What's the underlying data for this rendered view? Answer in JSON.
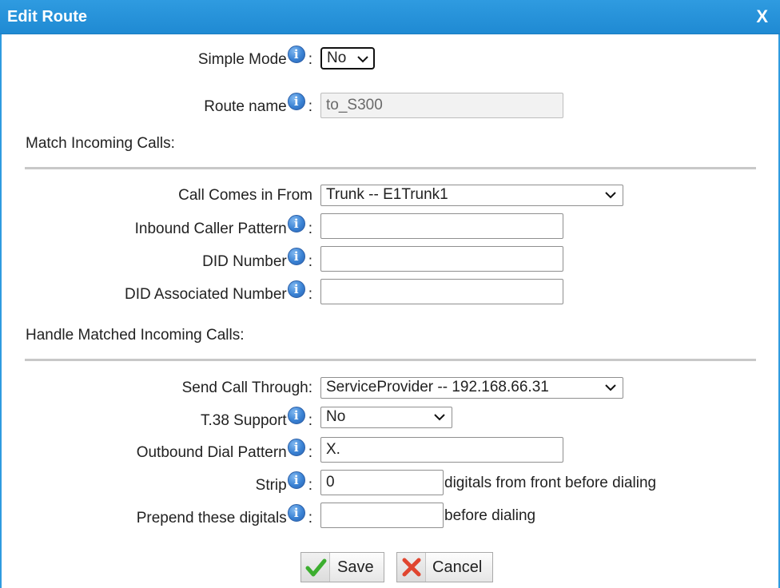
{
  "window": {
    "title": "Edit Route",
    "close_label": "X"
  },
  "colon": ":",
  "info_glyph": "i",
  "simple_mode": {
    "label": "Simple Mode",
    "value": "No"
  },
  "route_name": {
    "label": "Route name",
    "value": "to_S300"
  },
  "match_section": {
    "heading": "Match Incoming Calls:"
  },
  "call_comes_from": {
    "label": "Call Comes in From",
    "value": "Trunk -- E1Trunk1"
  },
  "inbound_caller_pattern": {
    "label": "Inbound Caller Pattern",
    "value": ""
  },
  "did_number": {
    "label": "DID Number",
    "value": ""
  },
  "did_associated_number": {
    "label": "DID Associated Number",
    "value": ""
  },
  "handle_section": {
    "heading": "Handle Matched Incoming Calls:"
  },
  "send_call_through": {
    "label": "Send Call Through:",
    "value": "ServiceProvider -- 192.168.66.31"
  },
  "t38_support": {
    "label": "T.38 Support",
    "value": "No"
  },
  "outbound_dial_pattern": {
    "label": "Outbound Dial Pattern",
    "value": "X."
  },
  "strip": {
    "label": "Strip",
    "value": "0",
    "suffix": "digitals from front before dialing"
  },
  "prepend": {
    "label": "Prepend these digitals",
    "value": "",
    "suffix": "before dialing"
  },
  "buttons": {
    "save": "Save",
    "cancel": "Cancel"
  },
  "colors": {
    "titlebar": "#2f9be0",
    "save_icon": "#3cae2f",
    "cancel_icon": "#e0452f"
  }
}
